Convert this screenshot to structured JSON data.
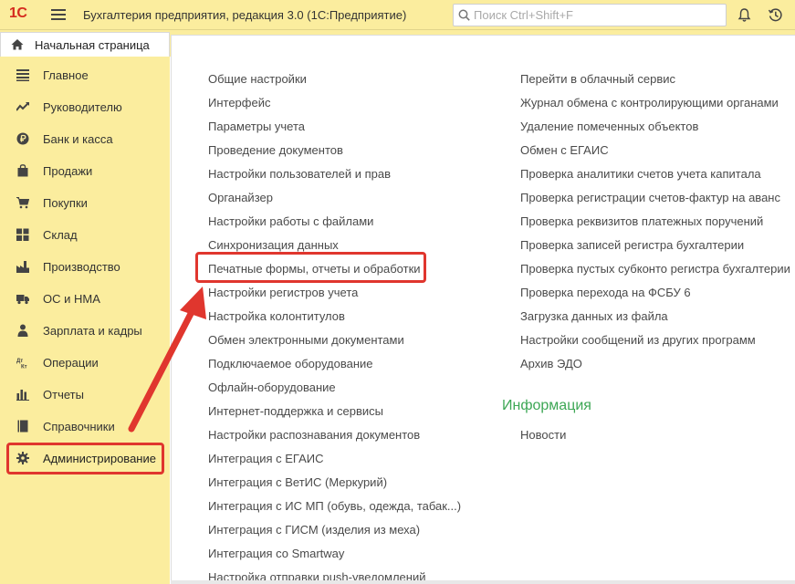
{
  "app": {
    "logo": "1С",
    "title": "Бухгалтерия предприятия, редакция 3.0  (1С:Предприятие)"
  },
  "search": {
    "placeholder": "Поиск Ctrl+Shift+F",
    "value": ""
  },
  "home_tab": {
    "label": "Начальная страница"
  },
  "sidebar": {
    "items": [
      {
        "label": "Главное",
        "icon": "menu-lines-icon"
      },
      {
        "label": "Руководителю",
        "icon": "trend-chart-icon"
      },
      {
        "label": "Банк и касса",
        "icon": "ruble-coin-icon"
      },
      {
        "label": "Продажи",
        "icon": "shopping-bag-icon"
      },
      {
        "label": "Покупки",
        "icon": "shopping-cart-icon"
      },
      {
        "label": "Склад",
        "icon": "warehouse-grid-icon"
      },
      {
        "label": "Производство",
        "icon": "factory-icon"
      },
      {
        "label": "ОС и НМА",
        "icon": "truck-icon"
      },
      {
        "label": "Зарплата и кадры",
        "icon": "person-icon"
      },
      {
        "label": "Операции",
        "icon": "debit-credit-icon"
      },
      {
        "label": "Отчеты",
        "icon": "bar-chart-icon"
      },
      {
        "label": "Справочники",
        "icon": "book-icon"
      },
      {
        "label": "Администрирование",
        "icon": "gear-icon",
        "active": true
      }
    ]
  },
  "main": {
    "left_links": [
      "Общие настройки",
      "Интерфейс",
      "Параметры учета",
      "Проведение документов",
      "Настройки пользователей и прав",
      "Органайзер",
      "Настройки работы с файлами",
      "Синхронизация данных",
      "Печатные формы, отчеты и обработки",
      "Настройки регистров учета",
      "Настройка колонтитулов",
      "Обмен электронными документами",
      "Подключаемое оборудование",
      "Офлайн-оборудование",
      "Интернет-поддержка и сервисы",
      "Настройки распознавания документов",
      "Интеграция с ЕГАИС",
      "Интеграция с ВетИС (Меркурий)",
      "Интеграция с ИС МП (обувь, одежда, табак...)",
      "Интеграция с ГИСМ (изделия из меха)",
      "Интеграция со Smartway",
      "Настройка отправки push-уведомлений"
    ],
    "right_links": [
      "Перейти в облачный сервис",
      "Журнал обмена с контролирующими органами",
      "Удаление помеченных объектов",
      "Обмен с ЕГАИС",
      "Проверка аналитики счетов учета капитала",
      "Проверка регистрации счетов-фактур на аванс",
      "Проверка реквизитов платежных поручений",
      "Проверка записей регистра бухгалтерии",
      "Проверка пустых субконто регистра бухгалтерии",
      "Проверка перехода на ФСБУ 6",
      "Загрузка данных из файла",
      "Настройки сообщений из других программ",
      "Архив ЭДО"
    ],
    "info_section": {
      "title": "Информация",
      "links": [
        "Новости"
      ]
    }
  },
  "colors": {
    "panel_bg": "#fbed9e",
    "highlight_red": "#e0362e",
    "section_green": "#3da755",
    "logo_red": "#d52b1e"
  }
}
